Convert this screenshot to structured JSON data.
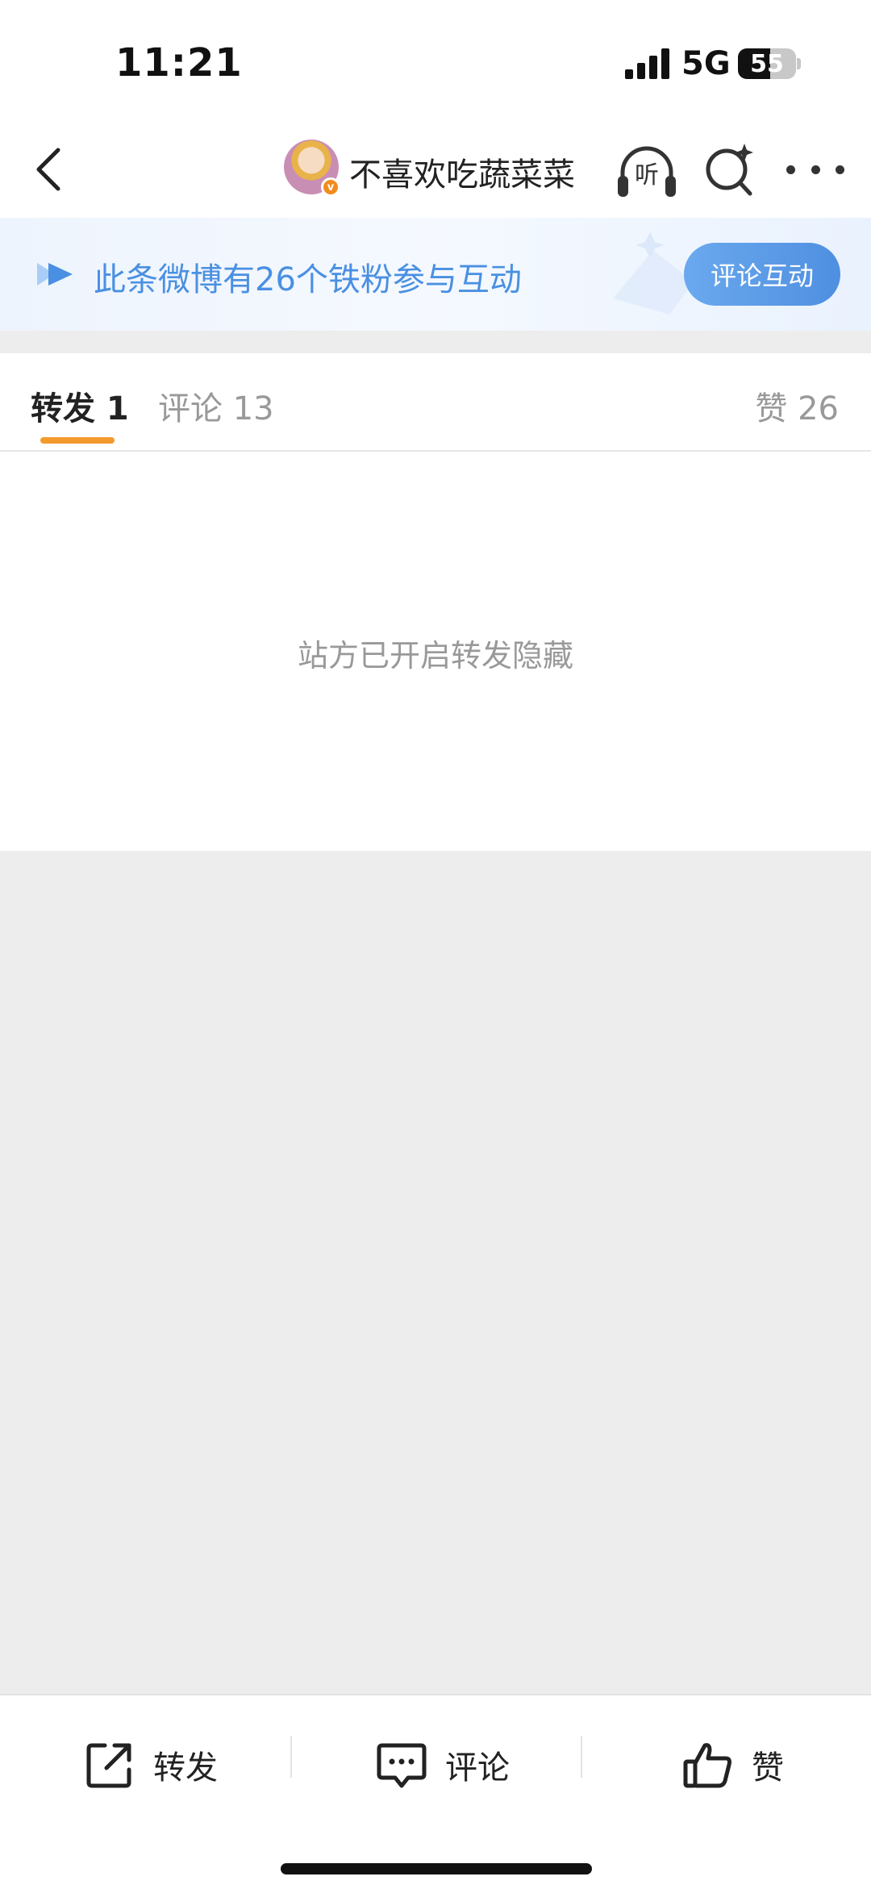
{
  "status_bar": {
    "time": "11:21",
    "network": "5G",
    "battery_level": "55",
    "battery_fraction": 0.55,
    "signal_bars": 4
  },
  "navbar": {
    "nickname": "不喜欢吃蔬菜菜",
    "listen_label": "听",
    "avatar_badge": "v"
  },
  "banner": {
    "text": "此条微博有26个铁粉参与互动",
    "button_label": "评论互动",
    "text_color": "#4a90e2"
  },
  "tabs": {
    "repost": "转发 1",
    "comment": "评论 13",
    "like": "赞 26",
    "active_color": "#f39a2d"
  },
  "content": {
    "message": "站方已开启转发隐藏"
  },
  "bottom_bar": {
    "repost_label": "转发",
    "comment_label": "评论",
    "like_label": "赞"
  }
}
